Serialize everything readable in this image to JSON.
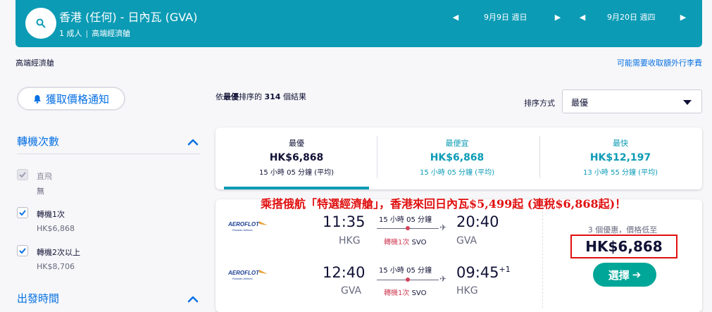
{
  "header": {
    "route": "香港 (任何) - 日內瓦 (GVA)",
    "passengers": "1 成人",
    "cabin": "高端經濟艙",
    "depart_date": "9月9日 週日",
    "return_date": "9月20日 週四"
  },
  "top_cabin_label": "高端經濟艙",
  "baggage_link": "可能需要收取額外行李費",
  "price_alert_button": "獲取價格通知",
  "filters": {
    "stops_title": "轉機次數",
    "options": [
      {
        "label": "直飛",
        "price": "無",
        "checked": true,
        "disabled": true
      },
      {
        "label": "轉機1次",
        "price": "HK$6,868",
        "checked": true,
        "disabled": false
      },
      {
        "label": "轉機2次以上",
        "price": "HK$8,706",
        "checked": true,
        "disabled": false
      }
    ],
    "depart_time_title": "出發時間"
  },
  "results": {
    "prefix": "依",
    "sort_name": "最優",
    "middle": "排序的 ",
    "count": "314",
    "suffix": " 個結果"
  },
  "sort": {
    "label": "排序方式",
    "selected": "最優"
  },
  "tabs": [
    {
      "title": "最優",
      "price": "HK$6,868",
      "duration": "15 小時 05 分鐘 (平均)",
      "active": true
    },
    {
      "title": "最便宜",
      "price": "HK$6,868",
      "duration": "15 小時 05 分鐘 (平均)",
      "active": false
    },
    {
      "title": "最快",
      "price": "HK$12,197",
      "duration": "13 小時 55 分鐘 (平均)",
      "active": false
    }
  ],
  "promo_text": "乘搭俄航「特選經濟艙」，香港來回日內瓦$5,499起 (連稅$6,868起)！",
  "flight": {
    "airline": "AEROFLOT",
    "airline_sub": "Russian Airlines",
    "legs": [
      {
        "depart_time": "11:35",
        "depart_airport": "HKG",
        "duration": "15 小時 05 分鐘",
        "stops": "轉機1次",
        "via": "SVO",
        "arrive_time": "20:40",
        "arrive_airport": "GVA",
        "day_offset": ""
      },
      {
        "depart_time": "12:40",
        "depart_airport": "GVA",
        "duration": "15 小時 05 分鐘",
        "stops": "轉機1次",
        "via": "SVO",
        "arrive_time": "09:45",
        "arrive_airport": "HKG",
        "day_offset": "+1"
      }
    ],
    "deals_text": "3 個優惠，價格低至",
    "price": "HK$6,868",
    "select_label": "選擇"
  },
  "colors": {
    "header_bg": "#0b9bb5",
    "link_blue": "#0770e3",
    "select_green": "#00a698",
    "promo_red": "#e01010",
    "stop_red": "#d1435b"
  }
}
